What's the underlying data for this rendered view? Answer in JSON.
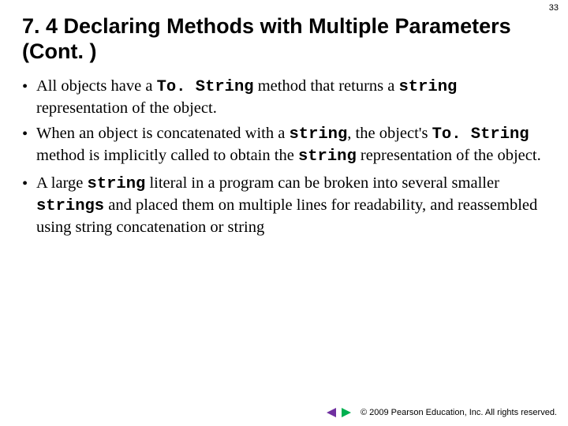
{
  "page_number": "33",
  "title": "7. 4  Declaring Methods with Multiple Parameters (Cont. )",
  "bullets": {
    "b0": {
      "t0": "All objects have a ",
      "c0": "To. String",
      "t1": " method that returns a ",
      "c1": "string",
      "t2": " representation of the object."
    },
    "b1": {
      "t0": "When an object is concatenated with a ",
      "c0": "string",
      "t1": ", the object's ",
      "c1": "To. String",
      "t2": " method is implicitly called to obtain the ",
      "c2": "string",
      "t3": " representation of the object."
    },
    "b2": {
      "t0": "A large ",
      "c0": "string",
      "t1": " literal in a program can be broken into several smaller ",
      "c1": "strings",
      "t2": " and placed them on multiple lines for readability, and reassembled using string concatenation or string"
    }
  },
  "footer": {
    "copyright": "© 2009 Pearson Education, Inc.  All rights reserved."
  },
  "nav": {
    "prev_color": "#7030a0",
    "next_color": "#00b050"
  }
}
